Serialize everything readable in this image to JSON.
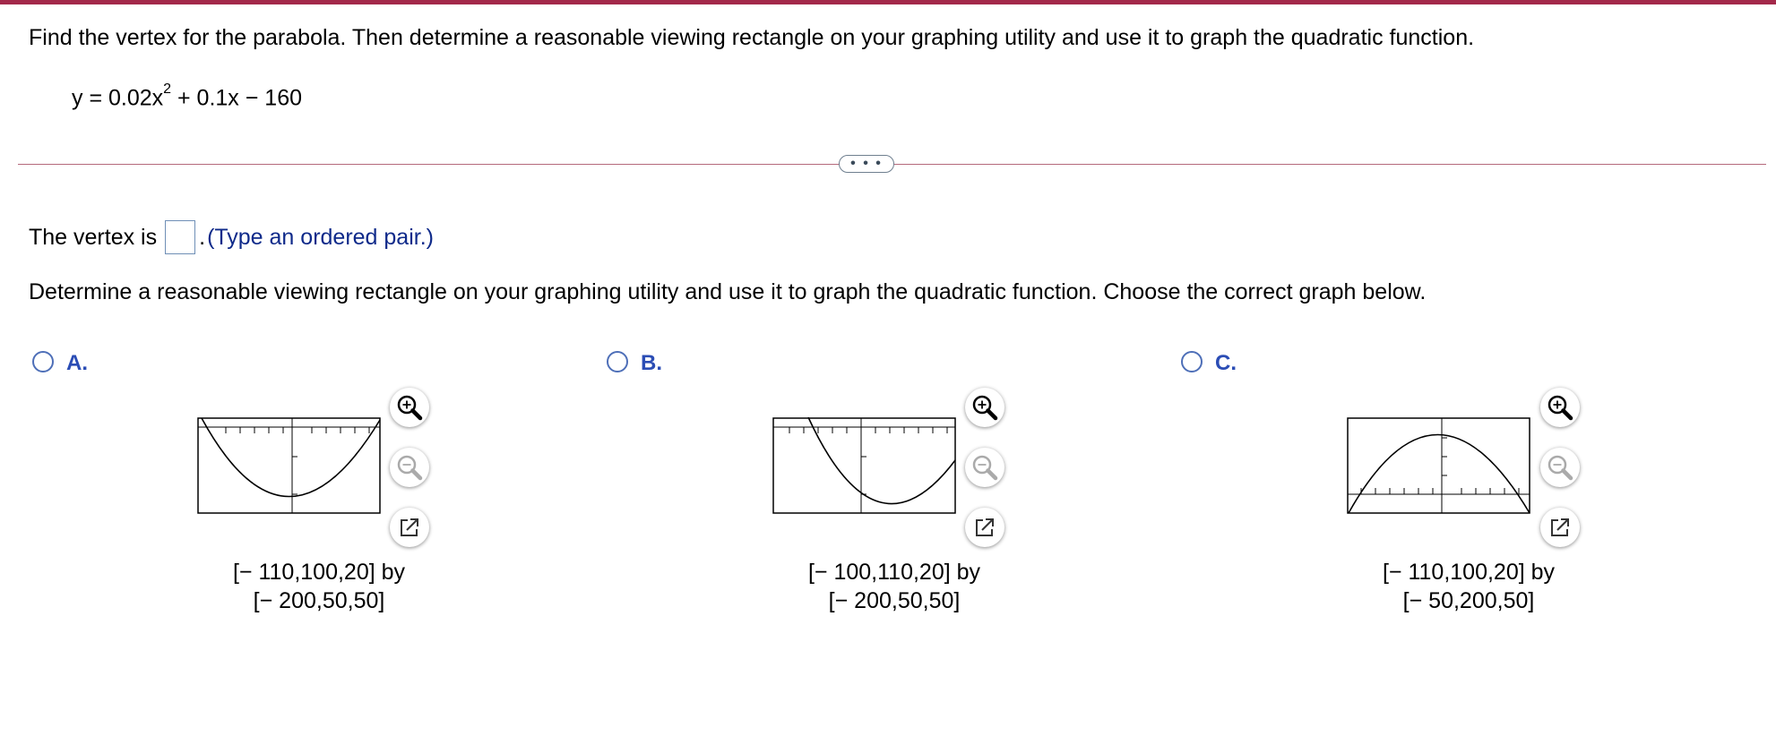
{
  "question": {
    "instruction": "Find the vertex for the parabola. Then determine a reasonable viewing rectangle on your graphing utility and use it to graph the quadratic function.",
    "equation": {
      "lhs": "y = 0.02x",
      "exponent": "2",
      "rest": " + 0.1x − 160"
    }
  },
  "divider": {
    "more_label": "• • •"
  },
  "vertex": {
    "prefix": "The vertex is",
    "answer_value": "",
    "suffix": ".",
    "hint": "(Type an ordered pair.)"
  },
  "determine": {
    "text": "Determine a reasonable viewing rectangle on your graphing utility and use it to graph the quadratic function. Choose the correct graph below."
  },
  "options": [
    {
      "label": "A.",
      "selected": false,
      "window_line1": "[− 110,100,20] by",
      "window_line2": "[− 200,50,50]",
      "curve": "opens-up"
    },
    {
      "label": "B.",
      "selected": false,
      "window_line1": "[− 100,110,20] by",
      "window_line2": "[− 200,50,50]",
      "curve": "opens-up"
    },
    {
      "label": "C.",
      "selected": false,
      "window_line1": "[− 110,100,20] by",
      "window_line2": "[− 50,200,50]",
      "curve": "opens-down"
    }
  ],
  "icons": [
    "zoom-in-icon",
    "zoom-out-icon",
    "open-new-window-icon"
  ],
  "colors": {
    "top_bar": "#a3294a",
    "option_label": "#2b4db5",
    "hint_text": "#0f2a8a"
  }
}
